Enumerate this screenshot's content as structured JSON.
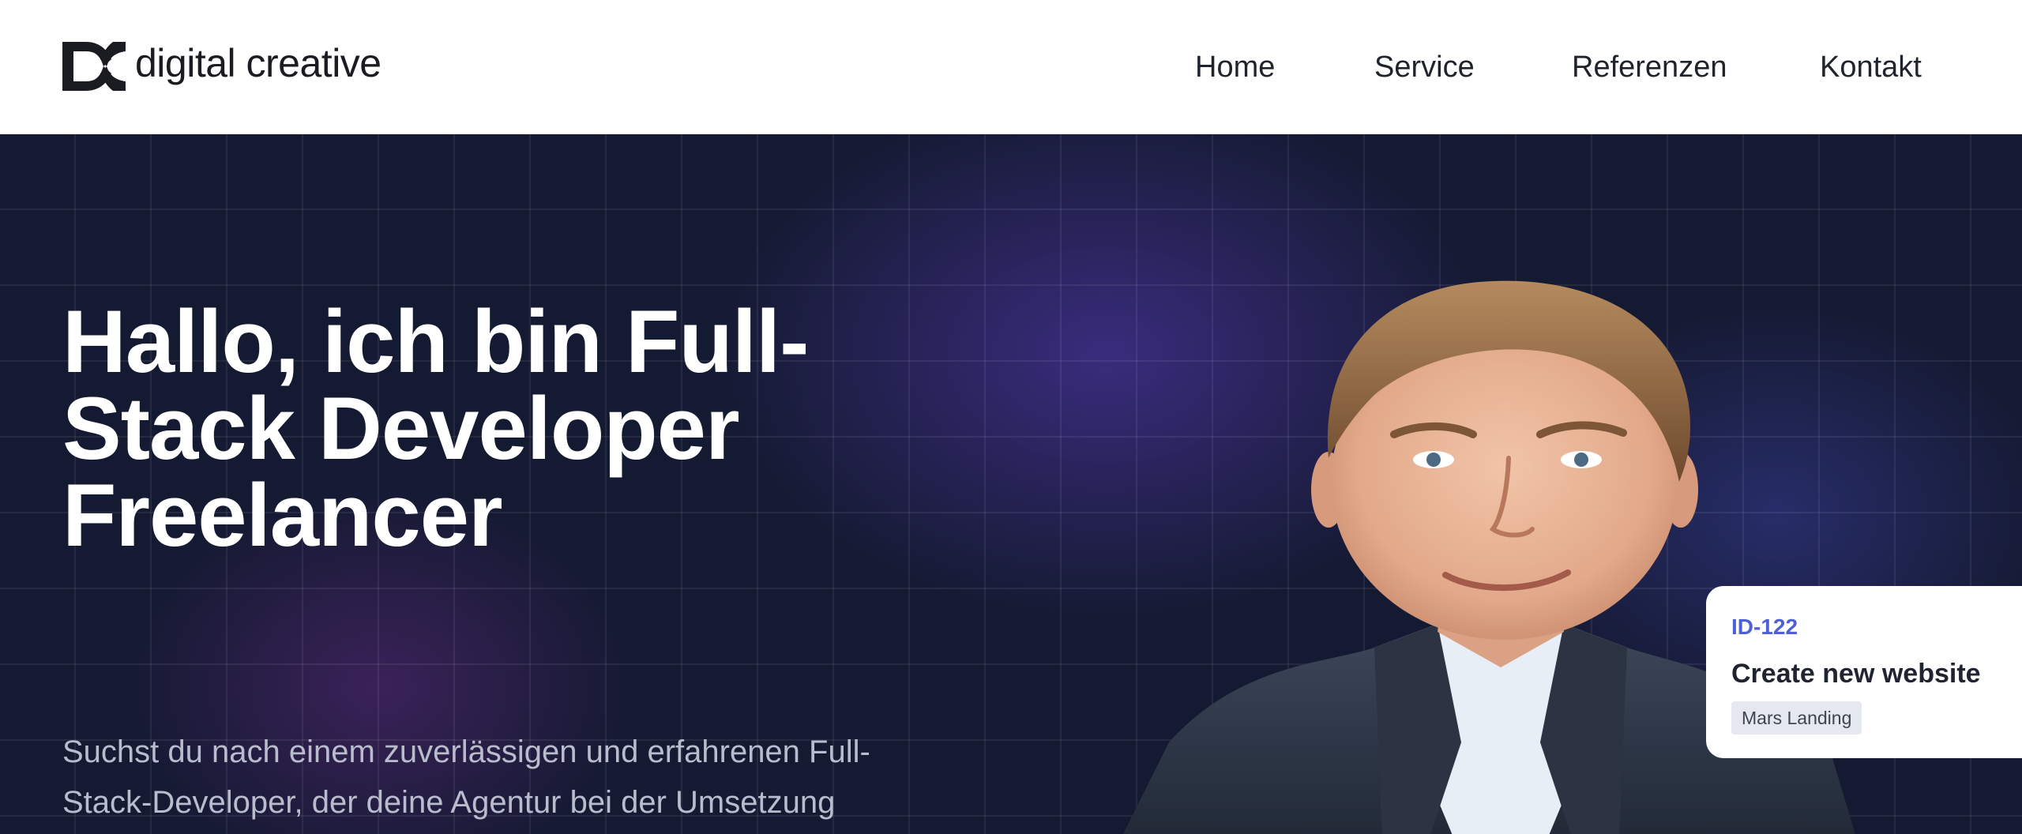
{
  "brand": {
    "name": "digital creative",
    "logo_icon": "dc-monogram-icon"
  },
  "nav": {
    "items": [
      {
        "label": "Home"
      },
      {
        "label": "Service"
      },
      {
        "label": "Referenzen"
      },
      {
        "label": "Kontakt"
      }
    ]
  },
  "hero": {
    "title_lines": [
      "Hallo, ich bin Full-",
      "Stack Developer",
      "Freelancer"
    ],
    "text_lines": [
      "Suchst du nach einem zuverlässigen und erfahrenen Full-",
      "Stack-Developer, der deine Agentur bei der Umsetzung"
    ],
    "portrait": "developer-portrait-photo"
  },
  "task_card": {
    "id": "ID-122",
    "title": "Create new website",
    "tag": "Mars Landing"
  },
  "colors": {
    "hero_background": "#151a33",
    "accent_blue": "#4f5fd6",
    "text_dark": "#1f232b"
  }
}
